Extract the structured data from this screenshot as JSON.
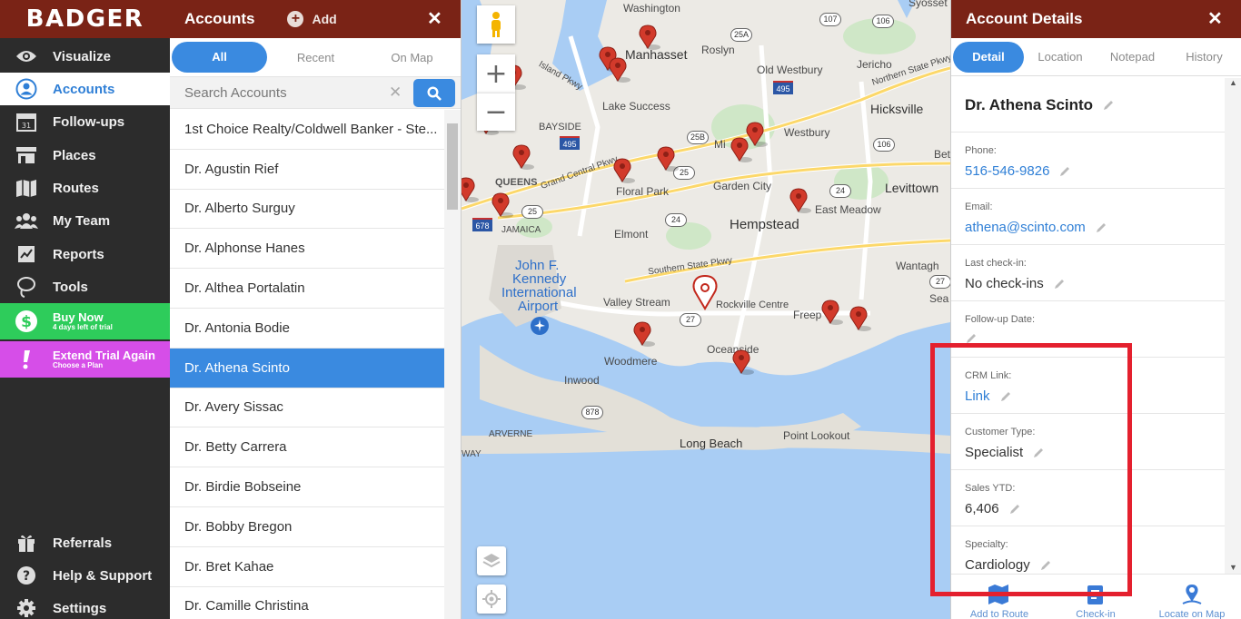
{
  "nav": {
    "logo": "BADGER",
    "items": [
      {
        "label": "Visualize",
        "icon": "eye-icon"
      },
      {
        "label": "Accounts",
        "icon": "user-circle-icon"
      },
      {
        "label": "Follow-ups",
        "icon": "calendar-icon"
      },
      {
        "label": "Places",
        "icon": "store-icon"
      },
      {
        "label": "Routes",
        "icon": "map-fold-icon"
      },
      {
        "label": "My Team",
        "icon": "team-icon"
      },
      {
        "label": "Reports",
        "icon": "chart-icon"
      },
      {
        "label": "Tools",
        "icon": "lasso-icon"
      }
    ],
    "buy_now": {
      "title": "Buy Now",
      "subtitle": "4 days left of trial",
      "color": "#2ecc5b"
    },
    "extend_trial": {
      "title": "Extend Trial Again",
      "subtitle": "Choose a Plan",
      "color": "#d64ee8"
    },
    "bottom_items": [
      {
        "label": "Referrals",
        "icon": "gift-icon"
      },
      {
        "label": "Help & Support",
        "icon": "help-icon"
      },
      {
        "label": "Settings",
        "icon": "gear-icon"
      }
    ]
  },
  "accounts": {
    "title": "Accounts",
    "add_label": "Add",
    "tabs": [
      "All",
      "Recent",
      "On Map"
    ],
    "search_placeholder": "Search Accounts",
    "items": [
      "1st Choice Realty/Coldwell Banker - Ste...",
      "Dr. Agustin Rief",
      "Dr. Alberto Surguy",
      "Dr. Alphonse Hanes",
      "Dr. Althea Portalatin",
      "Dr. Antonia Bodie",
      "Dr. Athena Scinto",
      "Dr. Avery Sissac",
      "Dr. Betty Carrera",
      "Dr. Birdie Bobseine",
      "Dr. Bobby Bregon",
      "Dr. Bret Kahae",
      "Dr. Camille Christina"
    ],
    "selected": "Dr. Athena Scinto"
  },
  "map": {
    "labels": [
      "Washington",
      "Manhasset",
      "Roslyn",
      "Old Westbury",
      "Jericho",
      "Syosset",
      "Lake Success",
      "Hicksville",
      "BAYSIDE",
      "Westbury",
      "Mi",
      "Bet",
      "QUEENS",
      "Floral Park",
      "Garden City",
      "Levittown",
      "East Meadow",
      "JAMAICA",
      "Elmont",
      "Hempstead",
      "Wantagh",
      "Valley Stream",
      "Rockville Centre",
      "Freep",
      "Sea",
      "Woodmere",
      "Oceanside",
      "Inwood",
      "ARVERNE",
      "Long Beach",
      "Point Lookout",
      "Kennedy",
      "John F.",
      "International",
      "Airport",
      "WAY",
      "Grand Central Pkwy",
      "Southern State Pkwy",
      "Northern State Pkwy",
      "Island Pkwy"
    ],
    "shields": [
      "107",
      "106",
      "25A",
      "495",
      "25B",
      "106",
      "24",
      "25",
      "25",
      "24",
      "678",
      "27",
      "27",
      "878",
      "495"
    ],
    "zoom_in": "+",
    "zoom_out": "−"
  },
  "details": {
    "title": "Account Details",
    "tabs": [
      "Detail",
      "Location",
      "Notepad",
      "History"
    ],
    "name": "Dr. Athena Scinto",
    "fields": [
      {
        "label": "Phone:",
        "value": "516-546-9826",
        "link": true
      },
      {
        "label": "Email:",
        "value": "athena@scinto.com",
        "link": true
      },
      {
        "label": "Last check-in:",
        "value": "No check-ins",
        "link": false
      },
      {
        "label": "Follow-up Date:",
        "value": "",
        "link": false
      },
      {
        "label": "CRM Link:",
        "value": "Link",
        "link": true
      },
      {
        "label": "Customer Type:",
        "value": "Specialist",
        "link": false
      },
      {
        "label": "Sales YTD:",
        "value": "6,406",
        "link": false
      },
      {
        "label": "Specialty:",
        "value": "Cardiology",
        "link": false
      }
    ],
    "footer": [
      "Add to Route",
      "Check-in",
      "Locate on Map"
    ]
  },
  "colors": {
    "brand": "#7a2316",
    "accent": "#3a8ae0",
    "highlight": "#e4202e"
  }
}
